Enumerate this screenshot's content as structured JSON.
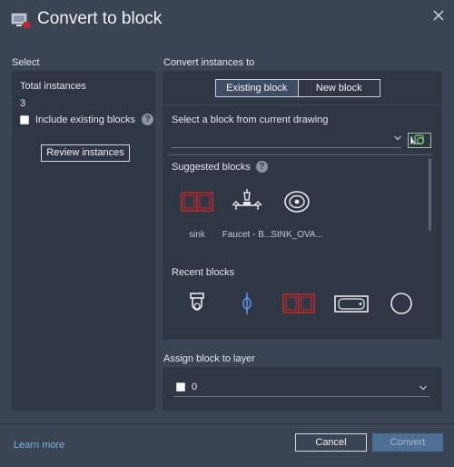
{
  "dialog": {
    "title": "Convert to block"
  },
  "select_section": {
    "label": "Select",
    "total_label": "Total instances",
    "total_count": "3",
    "include_label": "Include existing blocks",
    "review_button": "Review instances"
  },
  "convert_section": {
    "label": "Convert instances to",
    "tabs": [
      {
        "label": "Existing block",
        "active": true
      },
      {
        "label": "New block",
        "active": false
      }
    ],
    "select_label": "Select a block from current drawing",
    "dropdown_value": "",
    "suggested_label": "Suggested blocks",
    "suggested": [
      {
        "name": "sink",
        "icon": "double-sink-icon"
      },
      {
        "name": "Faucet - B...",
        "icon": "faucet-icon"
      },
      {
        "name": "SINK_OVA...",
        "icon": "oval-sink-icon"
      }
    ],
    "recent_label": "Recent blocks",
    "recent": [
      {
        "icon": "toilet-icon"
      },
      {
        "icon": "shower-valve-icon"
      },
      {
        "icon": "double-sink-icon"
      },
      {
        "icon": "bathtub-icon"
      },
      {
        "icon": "round-drain-icon"
      }
    ]
  },
  "layer_section": {
    "label": "Assign block to layer",
    "layer_value": "0"
  },
  "footer": {
    "learn_more": "Learn more",
    "cancel_button": "Cancel",
    "convert_button": "Convert"
  },
  "colors": {
    "background": "#3b4453",
    "panel": "#2f3745",
    "accent_block": "#c0282d",
    "primary_button": "#4e6f95",
    "link": "#7ab3e0"
  }
}
